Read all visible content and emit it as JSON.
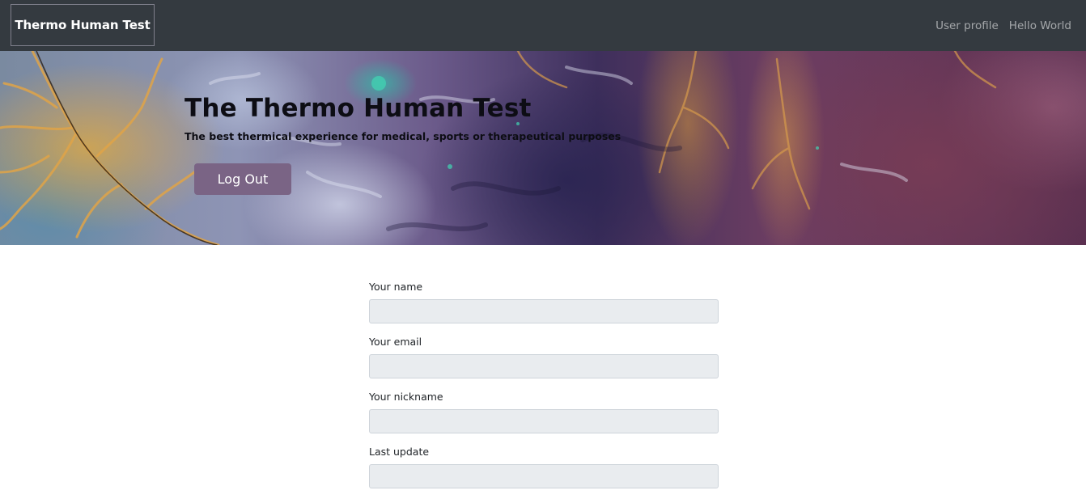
{
  "navbar": {
    "brand": "Thermo Human Test",
    "links": [
      "User profile",
      "Hello World"
    ]
  },
  "hero": {
    "title": "The Thermo Human Test",
    "subtitle": "The best thermical experience for medical, sports or therapeutical purposes",
    "logout_label": "Log Out"
  },
  "form": {
    "fields": [
      {
        "label": "Your name",
        "value": ""
      },
      {
        "label": "Your email",
        "value": ""
      },
      {
        "label": "Your nickname",
        "value": ""
      },
      {
        "label": "Last update",
        "value": ""
      }
    ]
  },
  "colors": {
    "navbar_bg": "#343a40",
    "button_bg": "#7a6485",
    "input_bg": "#e9ecef"
  }
}
